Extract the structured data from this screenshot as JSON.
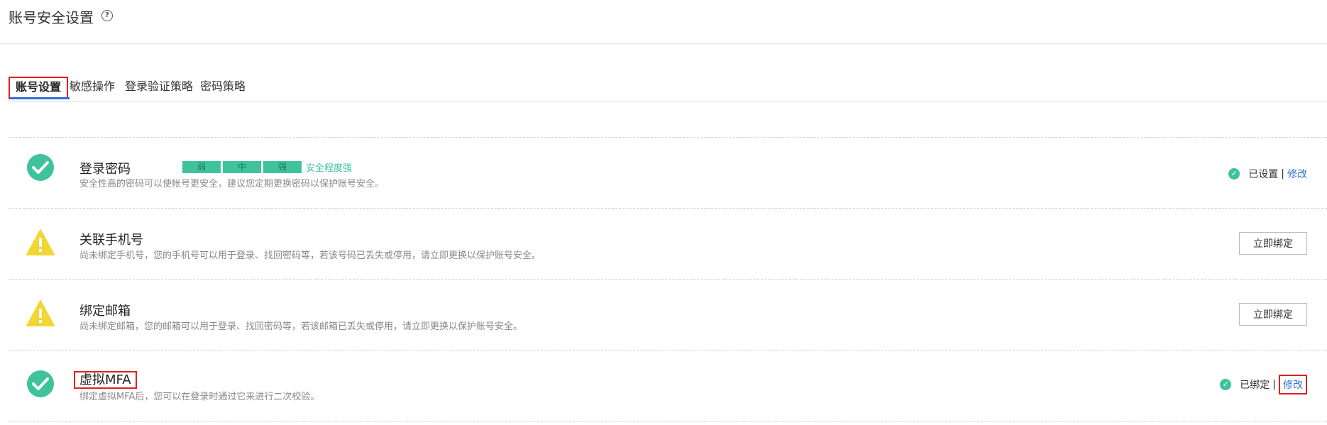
{
  "header": {
    "title": "账号安全设置",
    "help_glyph": "?"
  },
  "tabs": [
    {
      "label": "账号设置",
      "active": true
    },
    {
      "label": "敏感操作",
      "active": false
    },
    {
      "label": "登录验证策略",
      "active": false
    },
    {
      "label": "密码策略",
      "active": false
    }
  ],
  "items": [
    {
      "title": "登录密码",
      "desc": "安全性高的密码可以使帐号更安全，建议您定期更换密码以保护账号安全。",
      "icon": "check-circle-icon",
      "strength": {
        "levels": [
          "弱",
          "中",
          "强"
        ],
        "text": "安全程度强"
      },
      "status": {
        "text": "已设置",
        "separator": "|",
        "action": "修改"
      }
    },
    {
      "title": "关联手机号",
      "desc": "尚未绑定手机号，您的手机号可以用于登录、找回密码等，若该号码已丢失或停用，请立即更换以保护账号安全。",
      "icon": "warning-icon",
      "button": "立即绑定"
    },
    {
      "title": "绑定邮箱",
      "desc": "尚未绑定邮箱，您的邮箱可以用于登录、找回密码等，若该邮箱已丢失或停用，请立即更换以保护账号安全。",
      "icon": "warning-icon",
      "button": "立即绑定"
    },
    {
      "title": "虚拟MFA",
      "desc": "绑定虚拟MFA后，您可以在登录时通过它来进行二次校验。",
      "icon": "check-circle-icon",
      "status": {
        "text": "已绑定",
        "separator": "|",
        "action": "修改"
      }
    }
  ],
  "colors": {
    "success": "#3ec39c",
    "warning": "#f2d634",
    "link": "#2f6fd6",
    "highlight": "#e02020"
  }
}
